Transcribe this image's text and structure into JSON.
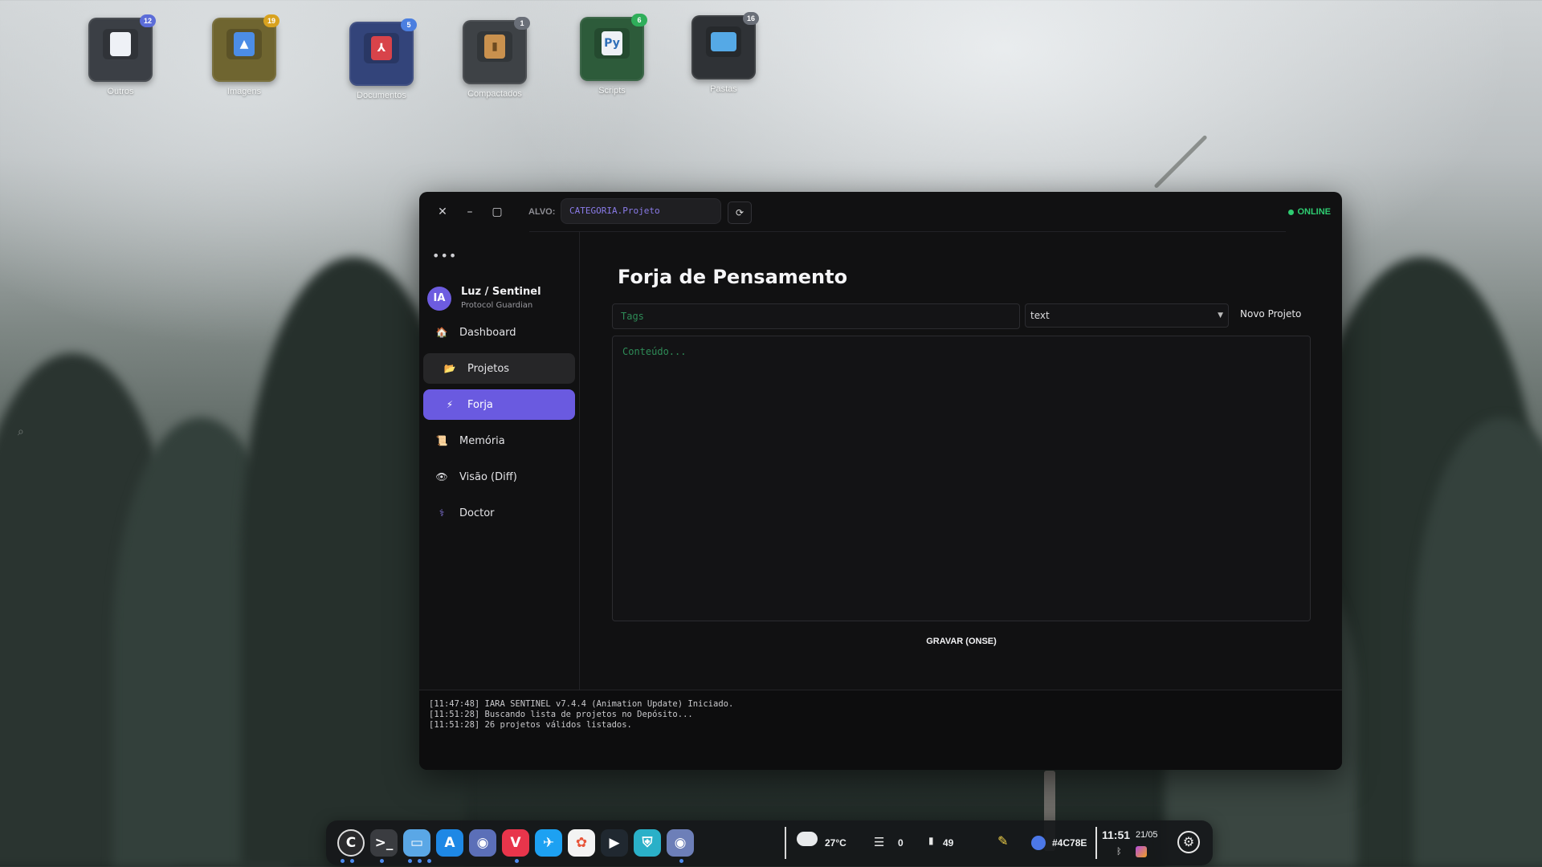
{
  "desktop": {
    "icons": [
      {
        "label": "Outros",
        "badge": "12",
        "icon": "code-file-icon",
        "color": "#3b3f45",
        "badge_color": "#5b6cd8"
      },
      {
        "label": "Imagens",
        "badge": "19",
        "icon": "image-file-icon",
        "color": "#6f6530",
        "badge_color": "#d8a21f"
      },
      {
        "label": "Documentos",
        "badge": "5",
        "icon": "pdf-file-icon",
        "color": "#33447a",
        "badge_color": "#4b7fe0"
      },
      {
        "label": "Compactados",
        "badge": "1",
        "icon": "archive-file-icon",
        "color": "#3e4246",
        "badge_color": "#6a6f78"
      },
      {
        "label": "Scripts",
        "badge": "6",
        "icon": "python-file-icon",
        "color": "#2d5b3a",
        "badge_color": "#2fae5a"
      },
      {
        "label": "Pastas",
        "badge": "16",
        "icon": "folder-icon",
        "color": "#2f3236",
        "badge_color": "#6a6f78"
      }
    ]
  },
  "window": {
    "controls": {
      "close": "✕",
      "minimize": "–",
      "maximize": "▢"
    },
    "alvo_label": "ALVO:",
    "alvo_value": "CATEGORIA.Projeto",
    "refresh": "⟳",
    "status": "ONLINE"
  },
  "sidebar": {
    "menu_dots": "•••",
    "avatar": "IA",
    "user_name": "Luz / Sentinel",
    "user_role": "Protocol Guardian",
    "items": [
      {
        "label": "Dashboard",
        "icon": "🏠"
      },
      {
        "label": "Projetos",
        "icon": "📂"
      },
      {
        "label": "Forja",
        "icon": "⚡"
      },
      {
        "label": "Memória",
        "icon": "📜"
      },
      {
        "label": "Visão (Diff)",
        "icon": "👁"
      },
      {
        "label": "Doctor",
        "icon": "⚕"
      }
    ]
  },
  "main": {
    "title": "Forja de Pensamento",
    "tags_placeholder": "Tags",
    "type_value": "text",
    "novo_projeto": "Novo Projeto",
    "content_placeholder": "Conteúdo...",
    "save_label": "GRAVAR (ONSE)"
  },
  "console": {
    "lines": [
      "[11:47:48] IARA SENTINEL v7.4.4 (Animation Update) Iniciado.",
      "[11:51:28] Buscando lista de projetos no Depósito...",
      "[11:51:28] 26 projetos válidos listados."
    ]
  },
  "dock": {
    "apps": [
      {
        "name": "app-launcher-icon",
        "glyph": "C",
        "bg": "#2a2a2c"
      },
      {
        "name": "terminal-icon",
        "glyph": ">_",
        "bg": "#3a3c40"
      },
      {
        "name": "files-icon",
        "glyph": "▭",
        "bg": "#5aa7e6"
      },
      {
        "name": "app-store-icon",
        "glyph": "A",
        "bg": "#1e88e5"
      },
      {
        "name": "iara-icon",
        "glyph": "◉",
        "bg": "#5b6fb8"
      },
      {
        "name": "vivaldi-icon",
        "glyph": "V",
        "bg": "#e8354b"
      },
      {
        "name": "swift-icon",
        "glyph": "✈",
        "bg": "#1da1f2"
      },
      {
        "name": "photos-icon",
        "glyph": "✿",
        "bg": "#f3f3f3"
      },
      {
        "name": "media-player-icon",
        "glyph": "▶",
        "bg": "#202830"
      },
      {
        "name": "shield-icon",
        "glyph": "⛨",
        "bg": "#2ab0c8"
      },
      {
        "name": "iara-sentinel-icon",
        "glyph": "◉",
        "bg": "#6d7fb8"
      }
    ],
    "temperature": "27°C",
    "tasks_count": "0",
    "files_count": "49",
    "color_hex": "#4C78E",
    "clock_time": "11:51",
    "clock_date": "21/05"
  }
}
